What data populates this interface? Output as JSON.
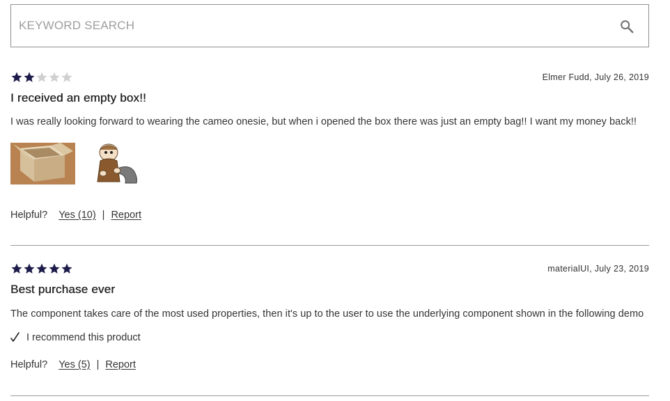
{
  "search": {
    "placeholder": "KEYWORD SEARCH",
    "value": "",
    "icon": "search-icon"
  },
  "colors": {
    "star_filled": "#1c1b4a",
    "star_empty": "#d0d0d0",
    "divider": "#9a9a9a",
    "border": "#8f8f8f"
  },
  "reviews": [
    {
      "rating": 2,
      "max_rating": 5,
      "meta": "Elmer Fudd, July 26, 2019",
      "title": "I received an empty box!!",
      "body": "I was really looking forward to wearing the cameo onesie, but when i opened the box there was just an empty bag!! I want my money back!!",
      "images": [
        "empty-cardboard-box-photo",
        "elmer-fudd-cartoon-image"
      ],
      "helpful_label": "Helpful?",
      "yes_label": "Yes (10)",
      "separator": "|",
      "report_label": "Report"
    },
    {
      "rating": 5,
      "max_rating": 5,
      "meta": "materialUI, July 23, 2019",
      "title": "Best purchase ever",
      "body": "The component takes care of the most used properties, then it's up to the user to use the underlying component shown in the following demo",
      "recommend_label": "I recommend this product",
      "recommend_icon": "checkmark-icon",
      "helpful_label": "Helpful?",
      "yes_label": "Yes (5)",
      "separator": "|",
      "report_label": "Report"
    }
  ]
}
